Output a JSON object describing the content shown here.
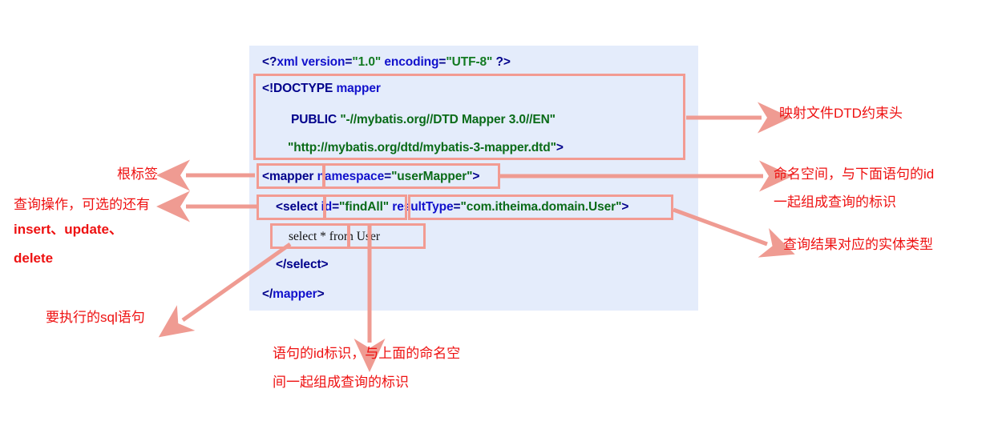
{
  "code": {
    "lines": [
      {
        "id": "xml-decl",
        "segments": [
          {
            "text": "<?",
            "cls": "tok-navy"
          },
          {
            "text": "xml",
            "cls": "tok-blue"
          },
          {
            "text": " ",
            "cls": "tok-navy"
          },
          {
            "text": "version",
            "cls": "tok-blue"
          },
          {
            "text": "=",
            "cls": "tok-navy"
          },
          {
            "text": "\"1.0\"",
            "cls": "tok-green"
          },
          {
            "text": " ",
            "cls": "tok-navy"
          },
          {
            "text": "encoding",
            "cls": "tok-blue"
          },
          {
            "text": "=",
            "cls": "tok-navy"
          },
          {
            "text": "\"UTF-8\"",
            "cls": "tok-green"
          },
          {
            "text": " ?>",
            "cls": "tok-navy"
          }
        ],
        "plain": "<?xml version=\"1.0\" encoding=\"UTF-8\" ?>"
      },
      {
        "id": "doctype",
        "segments": [
          {
            "text": "<!DOCTYPE ",
            "cls": "tok-navy"
          },
          {
            "text": "mapper",
            "cls": "tok-blue"
          }
        ],
        "plain": "<!DOCTYPE mapper"
      },
      {
        "id": "public-id",
        "segments": [
          {
            "text": "PUBLIC ",
            "cls": "tok-navy"
          },
          {
            "text": "\"-//mybatis.org//DTD Mapper 3.0//EN\"",
            "cls": "tok-dgreen"
          }
        ],
        "plain": "PUBLIC \"-//mybatis.org//DTD Mapper 3.0//EN\""
      },
      {
        "id": "system-id",
        "segments": [
          {
            "text": "\"http://mybatis.org/dtd/mybatis-3-mapper.dtd\"",
            "cls": "tok-dgreen"
          },
          {
            "text": ">",
            "cls": "tok-navy"
          }
        ],
        "plain": "\"http://mybatis.org/dtd/mybatis-3-mapper.dtd\">"
      },
      {
        "id": "mapper-open",
        "segments": [
          {
            "text": "<mapper ",
            "cls": "tok-navy"
          },
          {
            "text": "namespace",
            "cls": "tok-blue"
          },
          {
            "text": "=",
            "cls": "tok-navy"
          },
          {
            "text": "\"userMapper\"",
            "cls": "tok-dgreen"
          },
          {
            "text": ">",
            "cls": "tok-navy"
          }
        ],
        "plain": "<mapper namespace=\"userMapper\">"
      },
      {
        "id": "select-open",
        "segments": [
          {
            "text": "<select ",
            "cls": "tok-navy"
          },
          {
            "text": "id",
            "cls": "tok-blue"
          },
          {
            "text": "=",
            "cls": "tok-navy"
          },
          {
            "text": "\"findAll\"",
            "cls": "tok-dgreen"
          },
          {
            "text": " ",
            "cls": "tok-navy"
          },
          {
            "text": "resultType",
            "cls": "tok-blue"
          },
          {
            "text": "=",
            "cls": "tok-navy"
          },
          {
            "text": "\"com.itheima.domain.User\"",
            "cls": "tok-dgreen"
          },
          {
            "text": ">",
            "cls": "tok-navy"
          }
        ],
        "plain": "<select id=\"findAll\" resultType=\"com.itheima.domain.User\">"
      },
      {
        "id": "sql-statement",
        "segments": [
          {
            "text": "select * from User",
            "cls": "tok-black"
          }
        ],
        "plain": "select * from User"
      },
      {
        "id": "select-close",
        "segments": [
          {
            "text": "</",
            "cls": "tok-navy"
          },
          {
            "text": "select",
            "cls": "tok-navy"
          },
          {
            "text": ">",
            "cls": "tok-navy"
          }
        ],
        "plain": "</select>"
      },
      {
        "id": "mapper-close",
        "segments": [
          {
            "text": "</",
            "cls": "tok-navy"
          },
          {
            "text": "mapper",
            "cls": "tok-blue"
          },
          {
            "text": ">",
            "cls": "tok-navy"
          }
        ],
        "plain": "</mapper>"
      }
    ]
  },
  "annotations": {
    "dtd_header": "映射文件DTD约束头",
    "namespace_line1": "命名空间，与下面语句的id",
    "namespace_line2": "一起组成查询的标识",
    "result_type": "查询结果对应的实体类型",
    "root_tag": "根标签",
    "query_op_line1": "查询操作，可选的还有",
    "query_op_line2": "insert、update、",
    "query_op_line3": "delete",
    "sql_to_exec": "要执行的sql语句",
    "id_line1": "语句的id标识，与上面的命名空",
    "id_line2": "间一起组成查询的标识"
  },
  "colors": {
    "panel_bg": "#e4ecfb",
    "highlight_border": "#f29b92",
    "annotation_text": "#ee1111",
    "connector": "#ef9b92",
    "tag_navy": "#00008B",
    "attr_blue": "#1111cc",
    "value_green": "#127a22"
  }
}
